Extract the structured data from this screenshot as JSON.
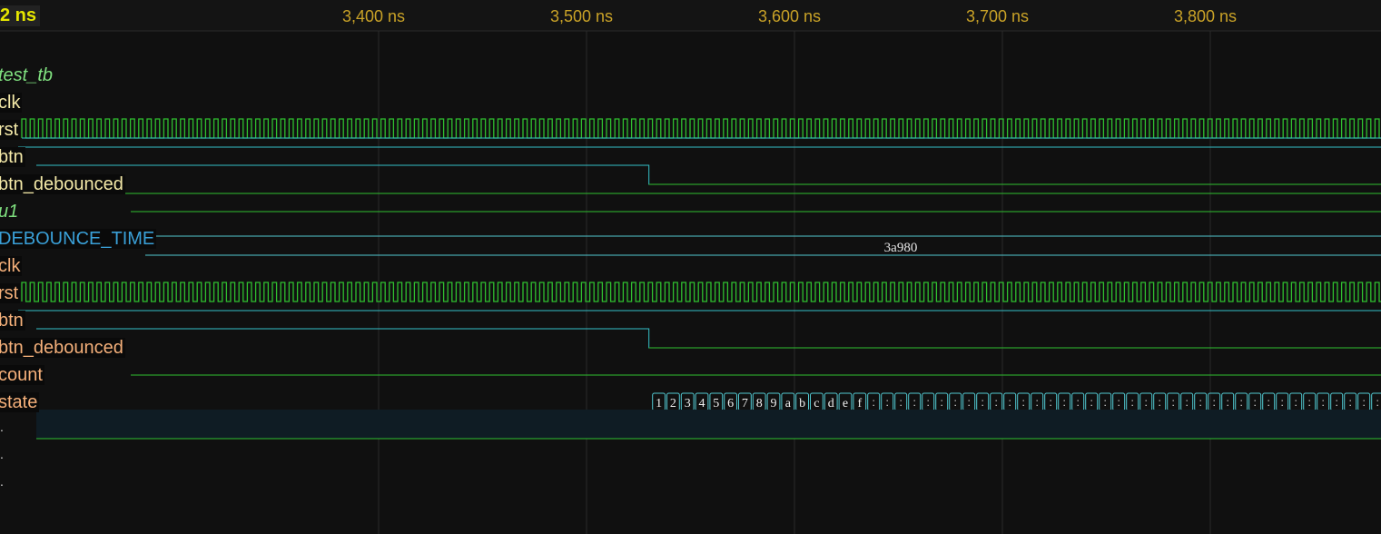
{
  "timeline": {
    "cursor_label": "2 ns",
    "ticks": [
      {
        "label": "3,400 ns",
        "t": 3400
      },
      {
        "label": "3,500 ns",
        "t": 3500
      },
      {
        "label": "3,600 ns",
        "t": 3600
      },
      {
        "label": "3,700 ns",
        "t": 3700
      },
      {
        "label": "3,800 ns",
        "t": 3800
      }
    ]
  },
  "signals": [
    {
      "label": "test_tb",
      "kind": "scope"
    },
    {
      "label": "clk",
      "kind": "sig"
    },
    {
      "label": "rst",
      "kind": "sig"
    },
    {
      "label": "btn",
      "kind": "sig"
    },
    {
      "label": "btn_debounced",
      "kind": "sig"
    },
    {
      "label": "u1",
      "kind": "scope"
    },
    {
      "label": "DEBOUNCE_TIME",
      "kind": "param"
    },
    {
      "label": "clk",
      "kind": "sig2"
    },
    {
      "label": "rst",
      "kind": "sig2"
    },
    {
      "label": "btn",
      "kind": "sig2"
    },
    {
      "label": "btn_debounced",
      "kind": "sig2"
    },
    {
      "label": "count",
      "kind": "sig2"
    },
    {
      "label": "state",
      "kind": "sig2"
    }
  ],
  "debounce_value": "3a980",
  "btn_fall_time": 3530,
  "count_values": [
    "1",
    "2",
    "3",
    "4",
    "5",
    "6",
    "7",
    "8",
    "9",
    "a",
    "b",
    "c",
    "d",
    "e",
    "f"
  ],
  "colors": {
    "high": "#35c0c8",
    "low": "#2fbf2f",
    "tick": "#c9a227",
    "grid": "#2a2a2a",
    "bus": "#52c8d0"
  }
}
